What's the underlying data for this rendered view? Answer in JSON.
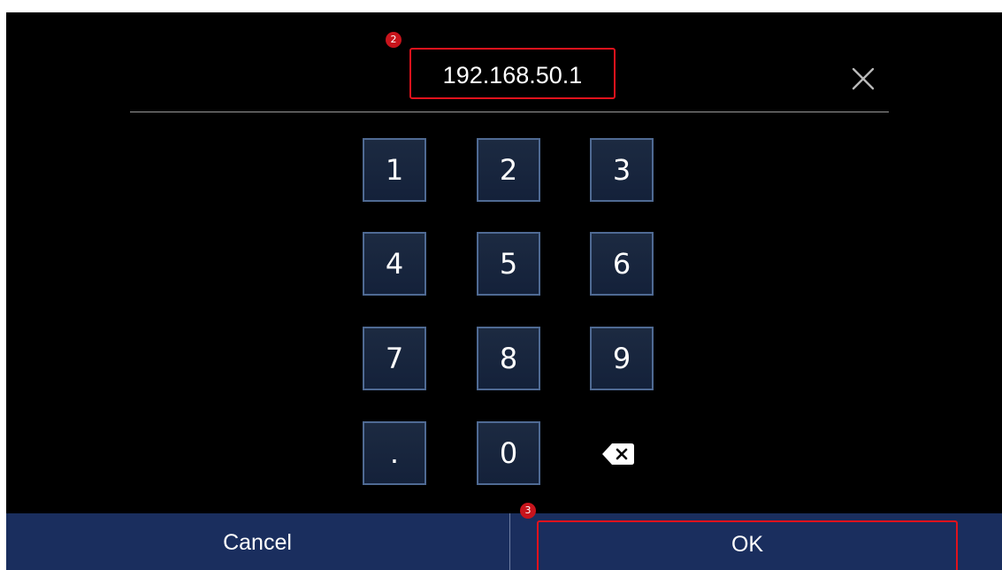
{
  "ip_field": {
    "value": "192.168.50.1",
    "marker": "2"
  },
  "clear_icon": "close-icon",
  "keypad": {
    "keys": [
      "1",
      "2",
      "3",
      "4",
      "5",
      "6",
      "7",
      "8",
      "9",
      ".",
      "0"
    ],
    "backspace_icon": "backspace-icon"
  },
  "footer": {
    "cancel_label": "Cancel",
    "ok_label": "OK",
    "ok_marker": "3"
  },
  "colors": {
    "background": "#000000",
    "key_fill": "#1c2a41",
    "key_border": "#4f6a93",
    "footer_bar": "#1a2e5e",
    "highlight": "#e1121c"
  }
}
